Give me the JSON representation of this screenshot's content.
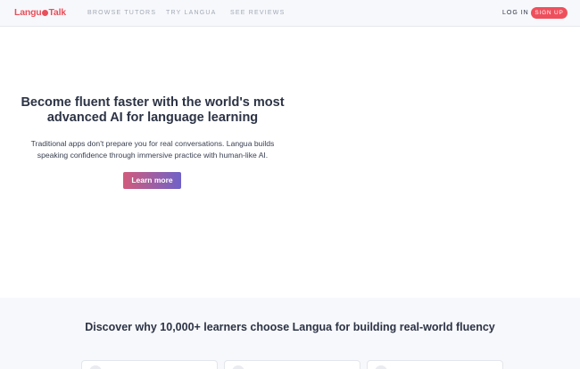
{
  "header": {
    "logo_text_a": "Langu",
    "logo_text_b": "Talk",
    "nav_links": [
      "BROWSE TUTORS",
      "TRY LANGUA",
      "SEE REVIEWS"
    ],
    "login_label": "LOG IN",
    "signup_label": "SIGN UP"
  },
  "hero": {
    "title": "Become fluent faster with the world's most advanced AI for language learning",
    "subtitle": "Traditional apps don't prepare you for real conversations. Langua builds speaking confidence through immersive practice with human-like AI.",
    "cta_label": "Learn more"
  },
  "features": {
    "title": "Discover why 10,000+ learners choose Langua for building real-world fluency"
  },
  "colors": {
    "brand": "#e8505b",
    "signup_bg": "#ef4f5c",
    "cta_gradient_start": "#d15b7c",
    "cta_gradient_end": "#6f62c7",
    "text_dark": "#2c3345",
    "nav_muted": "#a3a9b6"
  }
}
